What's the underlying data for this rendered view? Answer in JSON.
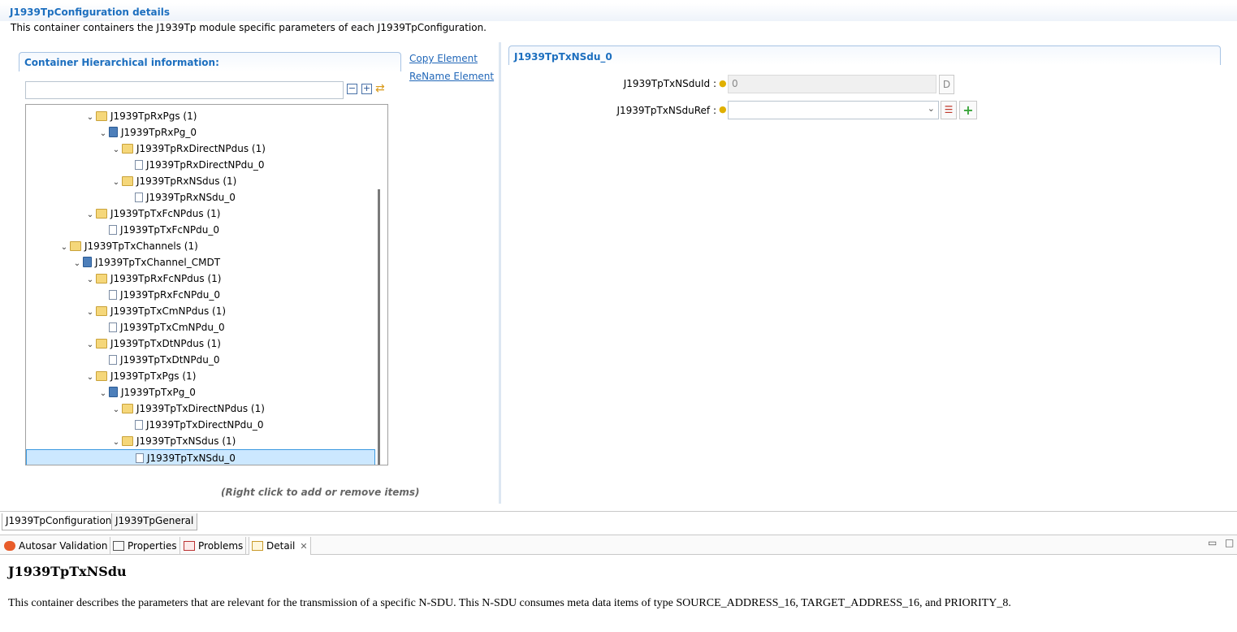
{
  "header": {
    "title": "J1939TpConfiguration details",
    "description": "This container containers the J1939Tp module specific parameters of each J1939TpConfiguration."
  },
  "hierarchy": {
    "title": "Container Hierarchical information:",
    "filter_value": "",
    "hint": "(Right click to add or remove items)",
    "tree": [
      {
        "label": "J1939TpRxPgs (1)",
        "icon": "folder-icon",
        "expanded": true
      },
      {
        "label": "J1939TpRxPg_0",
        "icon": "container-icon",
        "expanded": true
      },
      {
        "label": "J1939TpRxDirectNPdus (1)",
        "icon": "folder-icon",
        "expanded": true
      },
      {
        "label": "J1939TpRxDirectNPdu_0",
        "icon": "document-icon"
      },
      {
        "label": "J1939TpRxNSdus (1)",
        "icon": "folder-icon",
        "expanded": true
      },
      {
        "label": "J1939TpRxNSdu_0",
        "icon": "document-icon"
      },
      {
        "label": "J1939TpTxFcNPdus (1)",
        "icon": "folder-icon",
        "expanded": true
      },
      {
        "label": "J1939TpTxFcNPdu_0",
        "icon": "document-icon"
      },
      {
        "label": "J1939TpTxChannels (1)",
        "icon": "folder-icon",
        "expanded": true
      },
      {
        "label": "J1939TpTxChannel_CMDT",
        "icon": "container-icon",
        "expanded": true
      },
      {
        "label": "J1939TpRxFcNPdus (1)",
        "icon": "folder-icon",
        "expanded": true
      },
      {
        "label": "J1939TpRxFcNPdu_0",
        "icon": "document-icon"
      },
      {
        "label": "J1939TpTxCmNPdus (1)",
        "icon": "folder-icon",
        "expanded": true
      },
      {
        "label": "J1939TpTxCmNPdu_0",
        "icon": "document-icon"
      },
      {
        "label": "J1939TpTxDtNPdus (1)",
        "icon": "folder-icon",
        "expanded": true
      },
      {
        "label": "J1939TpTxDtNPdu_0",
        "icon": "document-icon"
      },
      {
        "label": "J1939TpTxPgs (1)",
        "icon": "folder-icon",
        "expanded": true
      },
      {
        "label": "J1939TpTxPg_0",
        "icon": "container-icon",
        "expanded": true
      },
      {
        "label": "J1939TpTxDirectNPdus (1)",
        "icon": "folder-icon",
        "expanded": true
      },
      {
        "label": "J1939TpTxDirectNPdu_0",
        "icon": "document-icon"
      },
      {
        "label": "J1939TpTxNSdus (1)",
        "icon": "folder-icon",
        "expanded": true
      },
      {
        "label": "J1939TpTxNSdu_0",
        "icon": "document-icon",
        "selected": true
      }
    ]
  },
  "actions": {
    "copy": "Copy Element",
    "rename": "ReName Element"
  },
  "element": {
    "title": "J1939TpTxNSdu_0",
    "fields": {
      "id_label": "J1939TpTxNSduId :",
      "id_value": "0",
      "id_default_button": "D",
      "ref_label": "J1939TpTxNSduRef :",
      "ref_value": ""
    }
  },
  "editor_tabs": [
    "J1939TpConfiguration",
    "J1939TpGeneral"
  ],
  "view_tabs": [
    "Autosar Validation",
    "Properties",
    "Problems",
    "Detail"
  ],
  "detail": {
    "title": "J1939TpTxNSdu",
    "description": "This container describes the parameters that are relevant for the transmission of a specific N-SDU. This N-SDU consumes meta data items of type SOURCE_ADDRESS_16, TARGET_ADDRESS_16, and PRIORITY_8."
  },
  "colors": {
    "section_title": "#1d6fbf",
    "link": "#2167b8",
    "selection": "#cce8ff"
  }
}
